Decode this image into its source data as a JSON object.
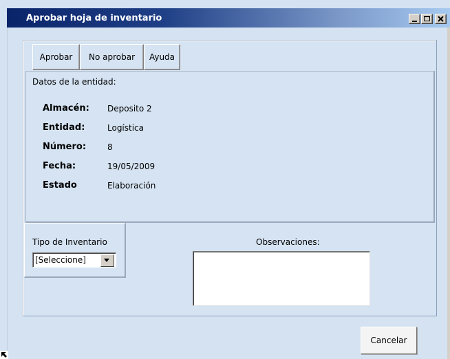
{
  "window": {
    "title": "Aprobar hoja de inventario",
    "controls": [
      "minimize",
      "maximize",
      "close"
    ]
  },
  "toolbar": {
    "approve_label": "Aprobar",
    "reject_label": "No aprobar",
    "help_label": "Ayuda"
  },
  "entity": {
    "section_title": "Datos de la entidad:",
    "fields": [
      {
        "label": "Almacén:",
        "value": "Deposito 2"
      },
      {
        "label": "Entidad:",
        "value": "Logística"
      },
      {
        "label": "Número:",
        "value": "8"
      },
      {
        "label": "Fecha:",
        "value": "19/05/2009"
      },
      {
        "label": "Estado",
        "value": "Elaboración"
      }
    ]
  },
  "inventory_type": {
    "label": "Tipo de Inventario",
    "selected": "[Seleccione]"
  },
  "observations": {
    "label": "Observaciones:",
    "value": ""
  },
  "footer": {
    "cancel_label": "Cancelar"
  },
  "colors": {
    "title_bar_start": "#0a246a",
    "title_bar_end": "#a6caf0",
    "background": "#d4e2f1"
  }
}
